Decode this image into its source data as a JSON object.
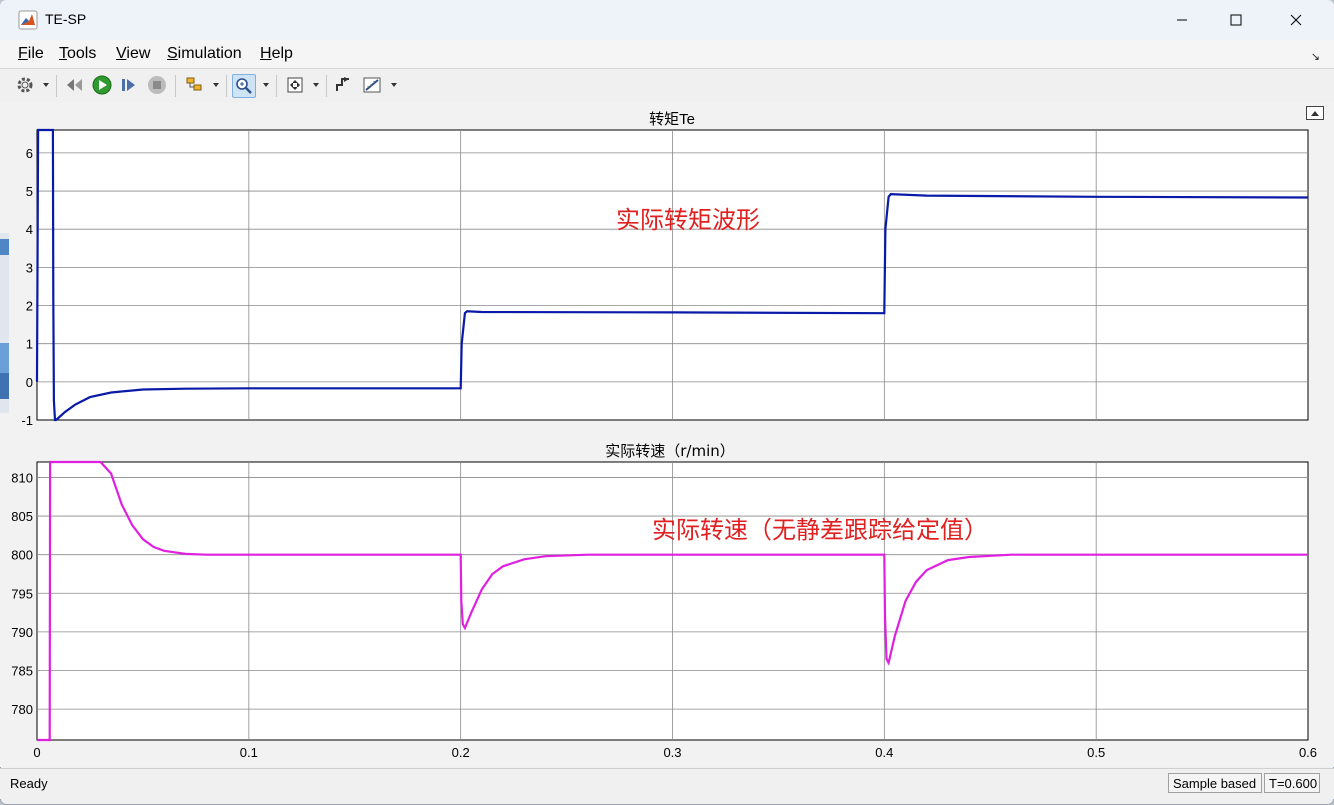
{
  "window": {
    "title": "TE-SP"
  },
  "menu": {
    "items": [
      {
        "label": "File",
        "key": "F"
      },
      {
        "label": "Tools",
        "key": "T"
      },
      {
        "label": "View",
        "key": "V"
      },
      {
        "label": "Simulation",
        "key": "S"
      },
      {
        "label": "Help",
        "key": "H"
      }
    ]
  },
  "toolbar": {
    "icons": [
      "settings-icon",
      "restore-icon",
      "run-icon",
      "step-forward-icon",
      "stop-icon",
      "highlight-icon",
      "zoom-icon",
      "autoscale-icon",
      "trigger-icon",
      "cursor-measure-icon"
    ]
  },
  "status": {
    "text": "Ready",
    "sample": "Sample based",
    "time": "T=0.600"
  },
  "chart_data": [
    {
      "type": "line",
      "title": "转矩Te",
      "annotation": "实际转矩波形",
      "xlim": [
        0,
        0.6
      ],
      "ylim": [
        -1,
        6.6
      ],
      "yticks": [
        -1,
        0,
        1,
        2,
        3,
        4,
        5,
        6
      ],
      "xticks": [],
      "grid": true,
      "color": "#0a1aa8",
      "series": [
        {
          "x": [
            0,
            0.0005,
            0.0075,
            0.0077,
            0.008,
            0.0085,
            0.009,
            0.013,
            0.018,
            0.025,
            0.035,
            0.05,
            0.07,
            0.1,
            0.15,
            0.2,
            0.2005,
            0.202,
            0.203,
            0.21,
            0.3,
            0.4,
            0.4005,
            0.402,
            0.403,
            0.42,
            0.5,
            0.6
          ],
          "y": [
            0,
            6.6,
            6.6,
            2.2,
            -0.5,
            -1.0,
            -1.0,
            -0.8,
            -0.6,
            -0.4,
            -0.28,
            -0.2,
            -0.18,
            -0.17,
            -0.17,
            -0.17,
            1.0,
            1.8,
            1.85,
            1.83,
            1.82,
            1.8,
            4.0,
            4.85,
            4.92,
            4.88,
            4.85,
            4.83
          ]
        }
      ]
    },
    {
      "type": "line",
      "title": "实际转速（r/min）",
      "annotation": "实际转速（无静差跟踪给定值）",
      "xlim": [
        0,
        0.6
      ],
      "ylim": [
        776,
        812
      ],
      "yticks": [
        780,
        785,
        790,
        795,
        800,
        805,
        810
      ],
      "xticks": [
        0,
        0.1,
        0.2,
        0.3,
        0.4,
        0.5,
        0.6
      ],
      "grid": true,
      "color": "#e020e0",
      "series": [
        {
          "x": [
            0,
            0.006,
            0.0062,
            0.0064,
            0.03,
            0.035,
            0.04,
            0.045,
            0.05,
            0.055,
            0.06,
            0.07,
            0.08,
            0.09,
            0.1,
            0.15,
            0.2,
            0.2003,
            0.201,
            0.202,
            0.205,
            0.21,
            0.215,
            0.22,
            0.23,
            0.24,
            0.26,
            0.3,
            0.4,
            0.4003,
            0.401,
            0.402,
            0.405,
            0.41,
            0.415,
            0.42,
            0.43,
            0.44,
            0.46,
            0.5,
            0.6
          ],
          "y": [
            776,
            776,
            812,
            812,
            812,
            810.5,
            806.5,
            803.8,
            802.0,
            801.0,
            800.5,
            800.1,
            800.0,
            800.0,
            800.0,
            800.0,
            800.0,
            794.0,
            791.0,
            790.5,
            792.5,
            795.5,
            797.5,
            798.5,
            799.4,
            799.8,
            800.0,
            800.0,
            800.0,
            792.0,
            786.5,
            786.0,
            789.5,
            794.0,
            796.5,
            798.0,
            799.3,
            799.7,
            800.0,
            800.0,
            800.0
          ]
        }
      ]
    }
  ]
}
